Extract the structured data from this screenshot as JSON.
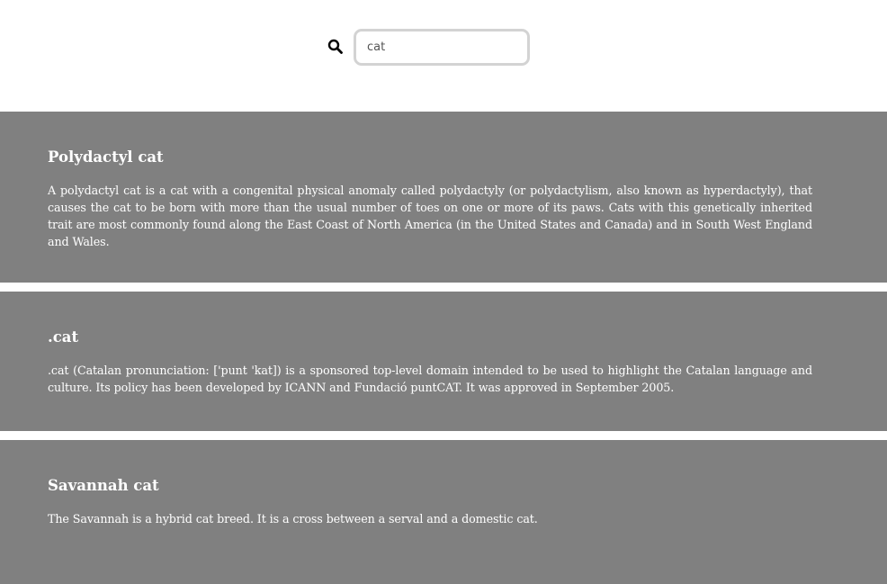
{
  "search": {
    "value": "cat",
    "icon": "search-icon"
  },
  "results": [
    {
      "title": "Polydactyl cat",
      "snippet": "A polydactyl cat is a cat with a congenital physical anomaly called polydactyly (or polydactylism, also known as hyperdactyly), that causes the cat to be born with more than the usual number of toes on one or more of its paws. Cats with this genetically inherited trait are most commonly found along the East Coast of North America (in the United States and Canada) and in South West England and Wales."
    },
    {
      "title": ".cat",
      "snippet": ".cat (Catalan pronunciation: ['punt 'kat]) is a sponsored top-level domain intended to be used to highlight the Catalan language and culture. Its policy has been developed by ICANN and Fundació puntCAT. It was approved in September 2005."
    },
    {
      "title": "Savannah cat",
      "snippet": "The Savannah is a hybrid cat breed. It is a cross between a serval and a domestic cat."
    }
  ],
  "colors": {
    "card_background": "#808080",
    "card_text": "#ffffff",
    "input_border": "#d3d3d3"
  }
}
